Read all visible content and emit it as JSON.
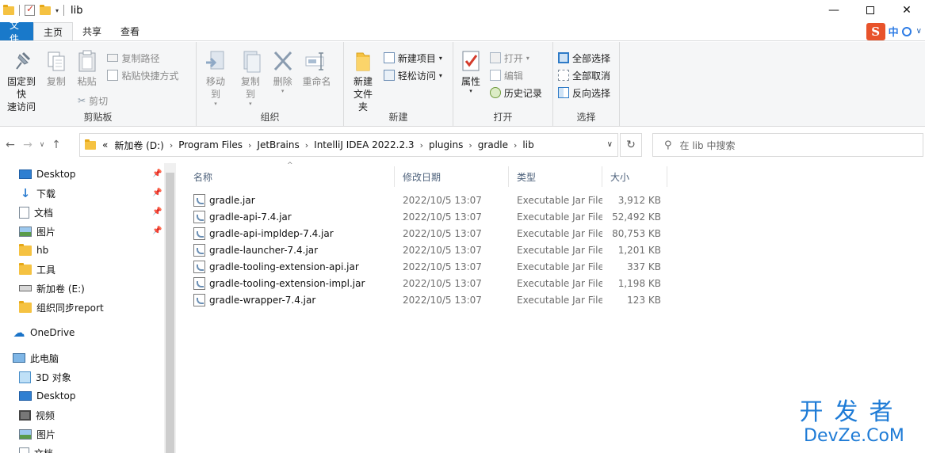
{
  "window": {
    "title": "lib"
  },
  "tabs": [
    {
      "label": "文件"
    },
    {
      "label": "主页"
    },
    {
      "label": "共享"
    },
    {
      "label": "查看"
    }
  ],
  "ime": {
    "logo": "S",
    "mode": "中"
  },
  "ribbon": {
    "clipboard": {
      "label": "剪贴板",
      "pin_line1": "固定到快",
      "pin_line2": "速访问",
      "copy": "复制",
      "paste": "粘贴",
      "copy_path": "复制路径",
      "paste_shortcut": "粘贴快捷方式",
      "cut": "剪切"
    },
    "organize": {
      "label": "组织",
      "move_to": "移动到",
      "copy_to": "复制到",
      "delete": "删除",
      "rename": "重命名"
    },
    "new": {
      "label": "新建",
      "new_folder_line1": "新建",
      "new_folder_line2": "文件夹",
      "new_item": "新建项目",
      "easy_access": "轻松访问"
    },
    "open": {
      "label": "打开",
      "properties": "属性",
      "open": "打开",
      "edit": "编辑",
      "history": "历史记录"
    },
    "select": {
      "label": "选择",
      "select_all": "全部选择",
      "select_none": "全部取消",
      "invert": "反向选择"
    }
  },
  "address": {
    "crumbs": [
      "«",
      "新加卷 (D:)",
      "Program Files",
      "JetBrains",
      "IntelliJ IDEA 2022.2.3",
      "plugins",
      "gradle",
      "lib"
    ]
  },
  "search": {
    "placeholder": "在 lib 中搜索"
  },
  "sidebar": {
    "items": [
      {
        "label": "Desktop",
        "icon": "desktop-icon",
        "pinned": true
      },
      {
        "label": "下载",
        "icon": "download-icon",
        "pinned": true
      },
      {
        "label": "文档",
        "icon": "document-icon",
        "pinned": true
      },
      {
        "label": "图片",
        "icon": "pictures-icon",
        "pinned": true
      },
      {
        "label": "hb",
        "icon": "folder-icon",
        "pinned": false
      },
      {
        "label": "工具",
        "icon": "folder-icon",
        "pinned": false
      },
      {
        "label": "新加卷 (E:)",
        "icon": "drive-icon",
        "pinned": false
      },
      {
        "label": "组织同步report",
        "icon": "folder-icon",
        "pinned": false
      },
      {
        "label": "OneDrive",
        "icon": "cloud-icon",
        "pinned": false
      },
      {
        "label": "此电脑",
        "icon": "computer-icon",
        "pinned": false
      },
      {
        "label": "3D 对象",
        "icon": "cube-icon",
        "pinned": false
      },
      {
        "label": "Desktop",
        "icon": "desktop-icon",
        "pinned": false
      },
      {
        "label": "视频",
        "icon": "video-icon",
        "pinned": false
      },
      {
        "label": "图片",
        "icon": "pictures-icon",
        "pinned": false
      },
      {
        "label": "文档",
        "icon": "document-icon",
        "pinned": false
      }
    ]
  },
  "filelist": {
    "columns": {
      "name": "名称",
      "date": "修改日期",
      "type": "类型",
      "size": "大小"
    },
    "rows": [
      {
        "name": "gradle.jar",
        "date": "2022/10/5 13:07",
        "type": "Executable Jar File",
        "size": "3,912 KB"
      },
      {
        "name": "gradle-api-7.4.jar",
        "date": "2022/10/5 13:07",
        "type": "Executable Jar File",
        "size": "52,492 KB"
      },
      {
        "name": "gradle-api-impldep-7.4.jar",
        "date": "2022/10/5 13:07",
        "type": "Executable Jar File",
        "size": "80,753 KB"
      },
      {
        "name": "gradle-launcher-7.4.jar",
        "date": "2022/10/5 13:07",
        "type": "Executable Jar File",
        "size": "1,201 KB"
      },
      {
        "name": "gradle-tooling-extension-api.jar",
        "date": "2022/10/5 13:07",
        "type": "Executable Jar File",
        "size": "337 KB"
      },
      {
        "name": "gradle-tooling-extension-impl.jar",
        "date": "2022/10/5 13:07",
        "type": "Executable Jar File",
        "size": "1,198 KB"
      },
      {
        "name": "gradle-wrapper-7.4.jar",
        "date": "2022/10/5 13:07",
        "type": "Executable Jar File",
        "size": "123 KB"
      }
    ]
  },
  "watermark": {
    "line1": "开发者",
    "line2": "DevZe.CoM"
  }
}
